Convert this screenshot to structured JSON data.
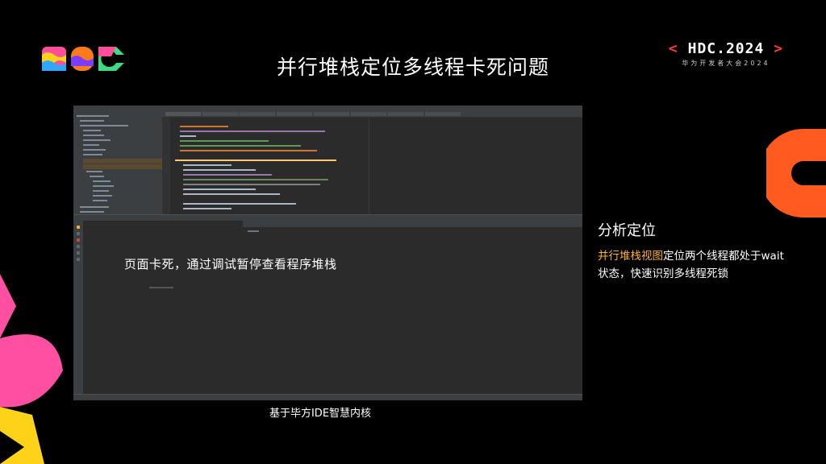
{
  "slide": {
    "title": "并行堆栈定位多线程卡死问题",
    "event_tag": {
      "bracket_left": "<",
      "name": "HDC.2024",
      "bracket_right": ">",
      "subtitle": "华为开发者大会2024"
    },
    "logo": {
      "icon": "hdc-logo"
    },
    "analysis": {
      "heading": "分析定位",
      "highlight": "并行堆栈视图",
      "body": "定位两个线程都处于wait状态，快速识别多线程死锁"
    },
    "caption": "基于毕方IDE智慧内核"
  },
  "ide": {
    "overlay_annotation": "页面卡死，通过调试暂停查看程序堆栈"
  },
  "colors": {
    "highlight": "#ffb020",
    "tag_bracket": "#ff3b3b",
    "ide_bg": "#2b2b2b",
    "ide_panel": "#3c3f41",
    "deco_orange": "#ff5a1f",
    "deco_pink": "#ff4fa3",
    "deco_yellow": "#ffd21a"
  }
}
